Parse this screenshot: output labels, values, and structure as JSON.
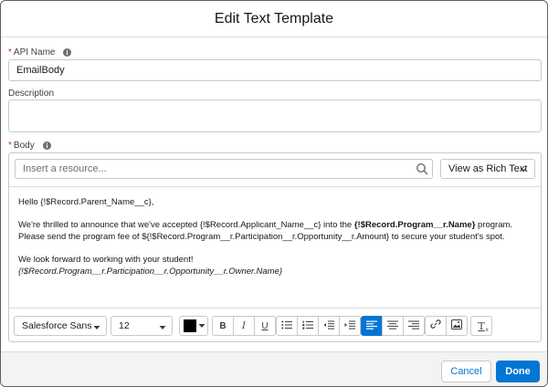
{
  "dialog": {
    "title": "Edit Text Template"
  },
  "fields": {
    "api_name": {
      "label": "API Name",
      "required_mark": "*",
      "value": "EmailBody"
    },
    "description": {
      "label": "Description",
      "value": ""
    },
    "body": {
      "label": "Body",
      "required_mark": "*"
    }
  },
  "resource_search": {
    "placeholder": "Insert a resource..."
  },
  "view_mode": {
    "selected": "View as Rich Text"
  },
  "editor": {
    "line1": "Hello {!$Record.Parent_Name__c},",
    "p2_a": "We're thrilled to announce that we've accepted {!$Record.Applicant_Name__c} into the ",
    "p2_bold": "{!$Record.Program__r.Name}",
    "p2_b": " program. Please send the program fee of ${!$Record.Program__r.Participation__r.Opportunity__r.Amount} to secure your student's spot.",
    "p3": "We look forward to working with your student!",
    "p4_italic": "{!$Record.Program__r.Participation__r.Opportunity__r.Owner.Name}"
  },
  "toolbar": {
    "font_family": "Salesforce Sans",
    "font_size": "12",
    "text_color": "#000000",
    "bold": "B",
    "italic": "I",
    "underline": "U",
    "clear_format": "T"
  },
  "footer": {
    "cancel_label": "Cancel",
    "done_label": "Done"
  },
  "colors": {
    "brand": "#0176d3",
    "required": "#c23934",
    "border": "#c9c9c9"
  },
  "icons": [
    "info-icon",
    "search-icon",
    "chevron-down-icon",
    "bulleted-list-icon",
    "numbered-list-icon",
    "decrease-indent-icon",
    "increase-indent-icon",
    "align-left-icon",
    "align-center-icon",
    "align-right-icon",
    "link-icon",
    "image-icon",
    "clear-format-icon"
  ]
}
